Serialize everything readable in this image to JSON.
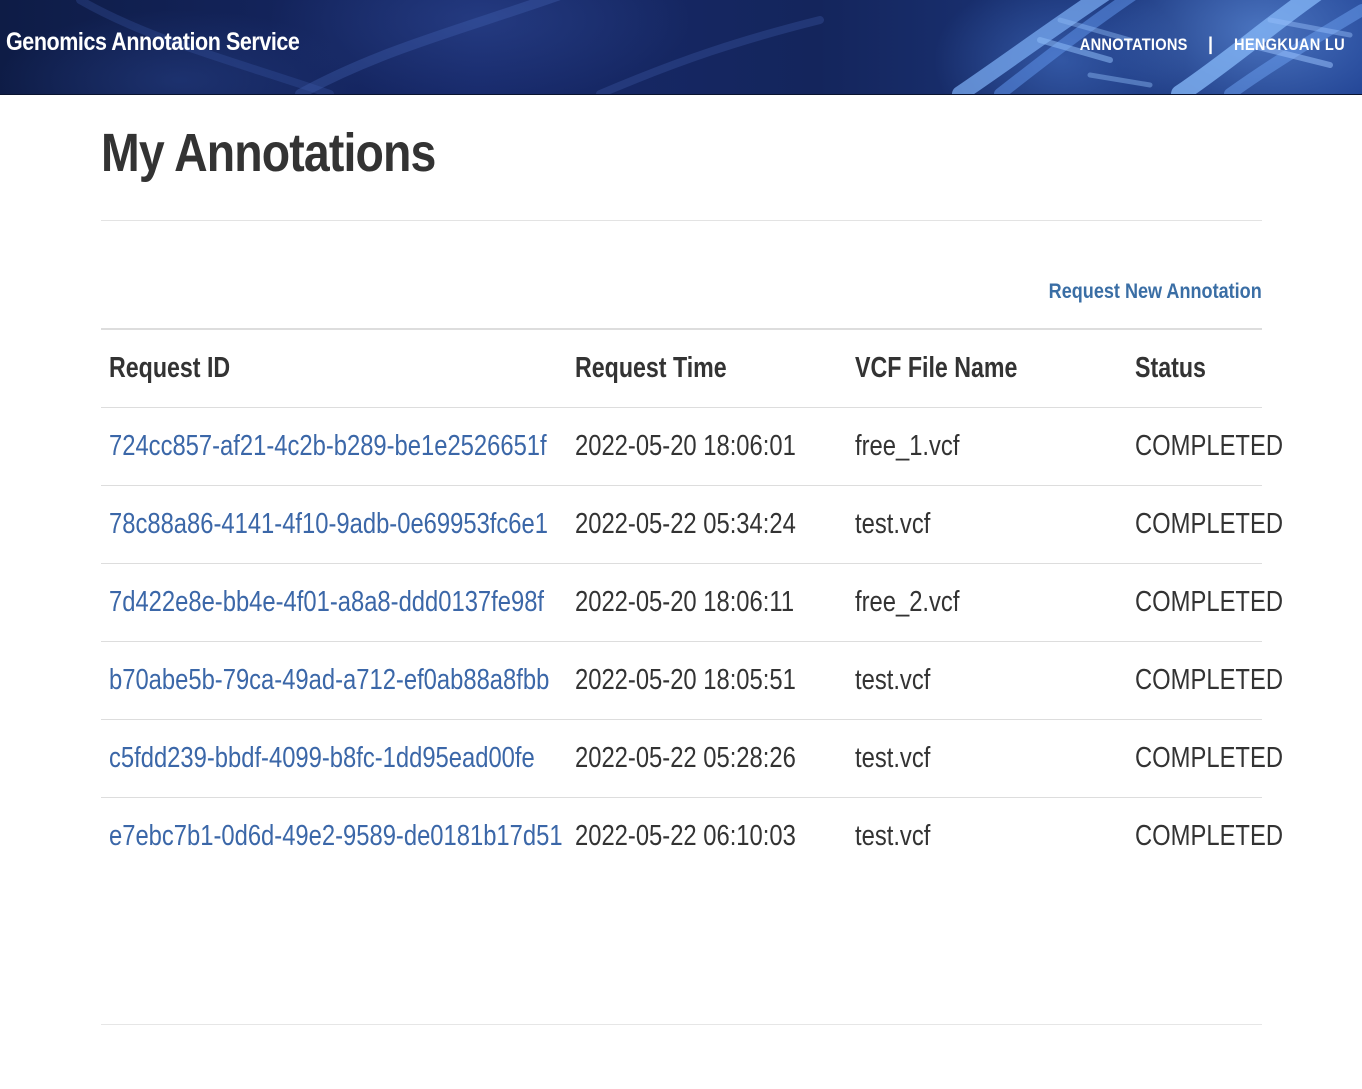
{
  "navbar": {
    "brand": "Genomics Annotation Service",
    "links": [
      {
        "label": "ANNOTATIONS"
      },
      {
        "label": "HENGKUAN LU"
      }
    ],
    "separator": "|"
  },
  "main": {
    "title": "My Annotations",
    "new_request_label": "Request New Annotation",
    "table": {
      "headers": [
        "Request ID",
        "Request Time",
        "VCF File Name",
        "Status"
      ],
      "rows": [
        {
          "id": "724cc857-af21-4c2b-b289-be1e2526651f",
          "time": "2022-05-20 18:06:01",
          "file": "free_1.vcf",
          "status": "COMPLETED"
        },
        {
          "id": "78c88a86-4141-4f10-9adb-0e69953fc6e1",
          "time": "2022-05-22 05:34:24",
          "file": "test.vcf",
          "status": "COMPLETED"
        },
        {
          "id": "7d422e8e-bb4e-4f01-a8a8-ddd0137fe98f",
          "time": "2022-05-20 18:06:11",
          "file": "free_2.vcf",
          "status": "COMPLETED"
        },
        {
          "id": "b70abe5b-79ca-49ad-a712-ef0ab88a8fbb",
          "time": "2022-05-20 18:05:51",
          "file": "test.vcf",
          "status": "COMPLETED"
        },
        {
          "id": "c5fdd239-bbdf-4099-b8fc-1dd95ead00fe",
          "time": "2022-05-22 05:28:26",
          "file": "test.vcf",
          "status": "COMPLETED"
        },
        {
          "id": "e7ebc7b1-0d6d-49e2-9589-de0181b17d51",
          "time": "2022-05-22 06:10:03",
          "file": "test.vcf",
          "status": "COMPLETED"
        }
      ]
    }
  },
  "colors": {
    "link": "#3b67a8",
    "text": "#333333",
    "navbar_bg": "#14255c"
  }
}
